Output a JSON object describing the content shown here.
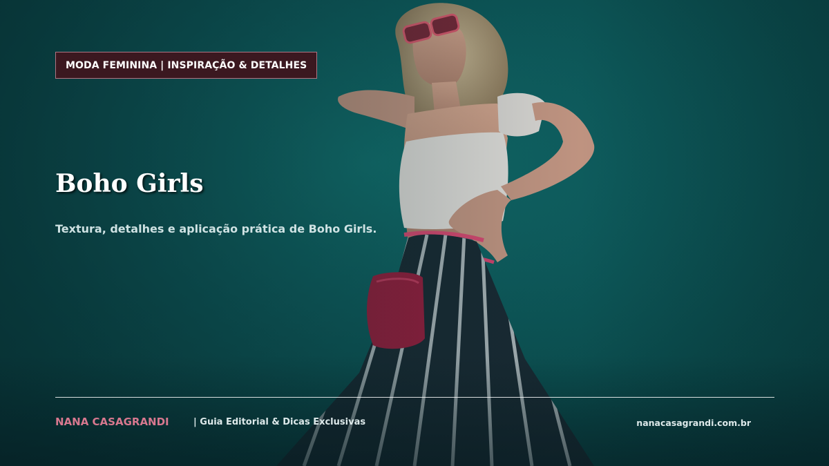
{
  "tag": {
    "label": "MODA FEMININA | INSPIRAÇÃO & DETALHES"
  },
  "headline": {
    "title": "Boho Girls",
    "subtitle": "Textura, detalhes e aplicação prática de Boho Girls."
  },
  "footer": {
    "brand": "NANA CASAGRANDI",
    "tagline": "|  Guia Editorial & Dicas Exclusivas",
    "site": "nanacasagrandi.com.br"
  },
  "colors": {
    "background": "#0e5d5e",
    "tag_background": "#3b1820",
    "tag_border": "#b07583",
    "brand": "#d8788f",
    "text": "#ffffff"
  }
}
